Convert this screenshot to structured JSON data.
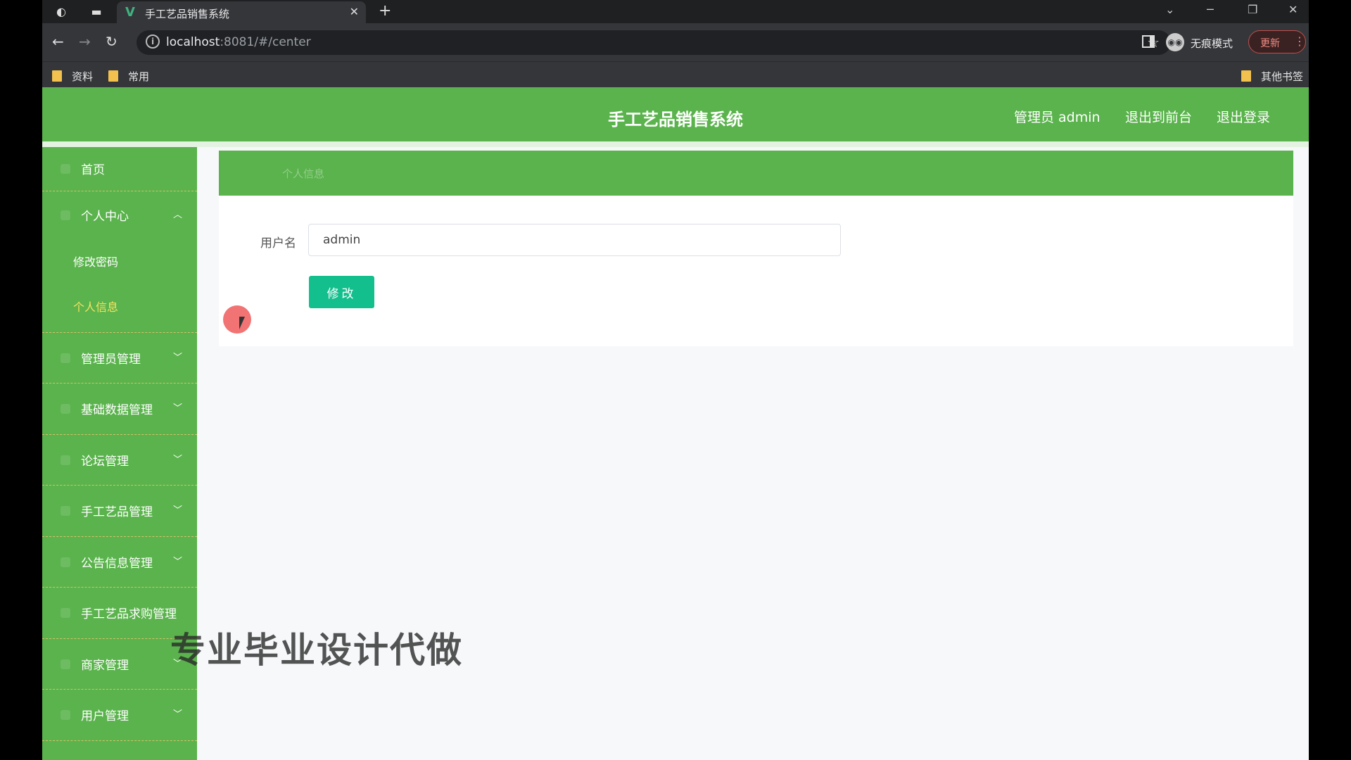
{
  "browser": {
    "tab_title": "手工艺品销售系统",
    "tab_favicon": "V",
    "url_host": "localhost",
    "url_rest": ":8081/#/center",
    "incognito_label": "无痕模式",
    "update_label": "更新",
    "bookmarks": [
      "资料",
      "常用"
    ],
    "other_bookmarks": "其他书签"
  },
  "header": {
    "title": "手工艺品销售系统",
    "user_label": "管理员 admin",
    "frontend_link": "退出到前台",
    "logout_link": "退出登录"
  },
  "sidebar": {
    "items": [
      {
        "label": "首页"
      },
      {
        "label": "个人中心",
        "sub": [
          "修改密码",
          "个人信息"
        ]
      },
      {
        "label": "管理员管理"
      },
      {
        "label": "基础数据管理"
      },
      {
        "label": "论坛管理"
      },
      {
        "label": "手工艺品管理"
      },
      {
        "label": "公告信息管理"
      },
      {
        "label": "手工艺品求购管理"
      },
      {
        "label": "商家管理"
      },
      {
        "label": "用户管理"
      }
    ]
  },
  "content": {
    "breadcrumb": "个人信息",
    "username_label": "用户名",
    "username_value": "admin",
    "submit_label": "修改"
  },
  "overlay": {
    "watermark": "专业毕业设计代做"
  }
}
